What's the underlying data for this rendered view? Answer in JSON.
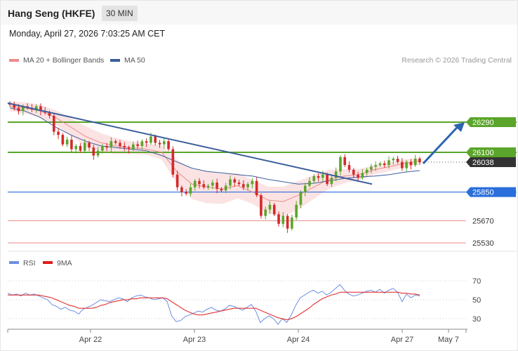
{
  "header": {
    "title": "Hang Seng (HKFE)",
    "timeframe": "30 MIN"
  },
  "datetime": "Monday, April 27, 2026 7:03:25 AM CET",
  "legend": {
    "bollinger_label": "MA 20 + Bollinger Bands",
    "ma50_label": "MA 50",
    "credit": "Research © 2026 Trading Central"
  },
  "colors": {
    "resistance": "#5aa52a",
    "support": "#2a6fdb",
    "target": "#ec8a8a",
    "trendline": "#3b5e9c",
    "arrow": "#2e64b0",
    "ma20": "#f08a8a",
    "bollinger_fill": "#fbe3e4",
    "ma50": "#3b5e9c",
    "candle_up": "#5aa52a",
    "candle_down": "#d42a2a",
    "rsi": "#6b8fe3",
    "rsi_ma": "#e01b1b"
  },
  "chart_data": [
    {
      "type": "candlestick",
      "title": "Hang Seng (HKFE)",
      "interval": "30 MIN",
      "x_tick_labels": [
        "Apr 22",
        "Apr 23",
        "Apr 24",
        "Apr 27",
        "May 7"
      ],
      "y_range": [
        25480,
        26560
      ],
      "price_levels": [
        {
          "value": 26290,
          "label": "26290",
          "role": "resistance"
        },
        {
          "value": 26100,
          "label": "26100",
          "role": "resistance"
        },
        {
          "value": 26038,
          "label": "26038",
          "role": "last-price"
        },
        {
          "value": 25850,
          "label": "25850",
          "role": "support"
        },
        {
          "value": 25670,
          "label": "25670",
          "role": "target"
        },
        {
          "value": 25530,
          "label": "25530",
          "role": "target"
        }
      ],
      "series": [
        {
          "name": "MA 20 + Bollinger Bands",
          "kind": "band"
        },
        {
          "name": "MA 50",
          "kind": "line"
        }
      ],
      "candles_close": [
        26400,
        26380,
        26360,
        26390,
        26380,
        26370,
        26390,
        26360,
        26350,
        26330,
        26230,
        26210,
        26150,
        26180,
        26120,
        26140,
        26110,
        26160,
        26130,
        26080,
        26110,
        26140,
        26130,
        26170,
        26160,
        26140,
        26130,
        26120,
        26150,
        26140,
        26170,
        26160,
        26200,
        26160,
        26150,
        26170,
        26120,
        25960,
        25880,
        25850,
        25840,
        25880,
        25920,
        25900,
        25880,
        25890,
        25910,
        25870,
        25860,
        25890,
        25930,
        25910,
        25900,
        25880,
        25900,
        25920,
        25830,
        25700,
        25740,
        25770,
        25710,
        25650,
        25700,
        25620,
        25690,
        25770,
        25850,
        25890,
        25920,
        25950,
        25940,
        25960,
        25900,
        25940,
        25980,
        26070,
        26020,
        25990,
        25960,
        25940,
        25970,
        25990,
        26010,
        26020,
        26030,
        26020,
        26050,
        26060,
        26040,
        26000,
        26040,
        26020,
        26060,
        26038
      ],
      "ma20_approx": [
        26390,
        26380,
        26360,
        26320,
        26260,
        26200,
        26160,
        26140,
        26130,
        26120,
        26100,
        25980,
        25900,
        25880,
        25870,
        25890,
        25850,
        25800,
        25790,
        25830,
        25880,
        25930,
        25950,
        25960,
        25990,
        26010,
        26030,
        26045
      ],
      "ma50_approx": [
        26380,
        26360,
        26320,
        26260,
        26210,
        26170,
        26140,
        26130,
        26120,
        26110,
        26080,
        26040,
        26000,
        25980,
        25970,
        25960,
        25950,
        25930,
        25915,
        25900,
        25905,
        25920,
        25935,
        25945,
        25950,
        25960,
        25975,
        25985
      ]
    },
    {
      "type": "line",
      "title": "RSI",
      "y_ticks": [
        70,
        50,
        30
      ],
      "y_range": [
        15,
        82
      ],
      "series": [
        {
          "name": "RSI",
          "values": [
            57,
            55,
            56,
            54,
            57,
            55,
            56,
            54,
            52,
            50,
            45,
            43,
            40,
            42,
            39,
            38,
            35,
            40,
            42,
            44,
            47,
            50,
            49,
            48,
            50,
            52,
            51,
            48,
            52,
            54,
            55,
            53,
            52,
            50,
            51,
            52,
            48,
            33,
            27,
            28,
            32,
            34,
            36,
            38,
            37,
            40,
            42,
            39,
            38,
            40,
            44,
            43,
            41,
            39,
            42,
            45,
            38,
            26,
            30,
            33,
            30,
            24,
            30,
            26,
            34,
            44,
            52,
            55,
            58,
            60,
            57,
            59,
            55,
            58,
            62,
            66,
            60,
            56,
            54,
            55,
            57,
            59,
            60,
            58,
            61,
            57,
            60,
            62,
            58,
            48,
            56,
            52,
            55,
            54
          ]
        },
        {
          "name": "9MA",
          "values": [
            55,
            55,
            55,
            55,
            55,
            55,
            55,
            55,
            54,
            53,
            52,
            50,
            48,
            46,
            44,
            43,
            41,
            41,
            41,
            41,
            42,
            44,
            45,
            47,
            48,
            49,
            50,
            50,
            51,
            51,
            52,
            52,
            52,
            52,
            52,
            52,
            51,
            48,
            45,
            42,
            39,
            37,
            35,
            34,
            34,
            35,
            36,
            37,
            38,
            39,
            40,
            41,
            41,
            41,
            41,
            41,
            41,
            39,
            37,
            35,
            33,
            31,
            30,
            29,
            30,
            32,
            35,
            38,
            41,
            45,
            48,
            51,
            53,
            55,
            56,
            58,
            58,
            58,
            58,
            58,
            58,
            58,
            58,
            58,
            58,
            58,
            58,
            58,
            58,
            57,
            57,
            56,
            56,
            55
          ]
        }
      ]
    }
  ]
}
